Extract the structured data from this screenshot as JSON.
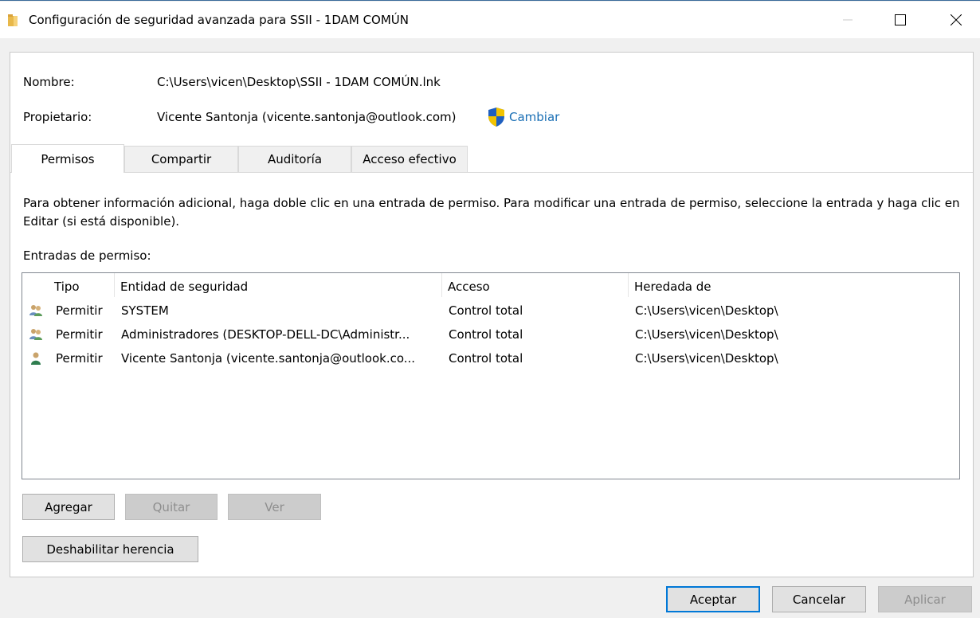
{
  "window": {
    "title": "Configuración de seguridad avanzada para SSII - 1DAM COMÚN",
    "icon": "folder-icon",
    "controls": [
      "minimize-icon",
      "maximize-icon",
      "close-icon"
    ]
  },
  "fields": {
    "name_label": "Nombre:",
    "name_value": "C:\\Users\\vicen\\Desktop\\SSII - 1DAM COMÚN.lnk",
    "owner_label": "Propietario:",
    "owner_value": "Vicente Santonja (vicente.santonja@outlook.com)",
    "change_link": "Cambiar"
  },
  "tabs": [
    {
      "label": "Permisos",
      "active": true
    },
    {
      "label": "Compartir",
      "active": false
    },
    {
      "label": "Auditoría",
      "active": false
    },
    {
      "label": "Acceso efectivo",
      "active": false
    }
  ],
  "info_text": "Para obtener información adicional, haga doble clic en una entrada de permiso. Para modificar una entrada de permiso, seleccione la entrada y haga clic en Editar (si está disponible).",
  "entries_label": "Entradas de permiso:",
  "table": {
    "columns": [
      "Tipo",
      "Entidad de seguridad",
      "Acceso",
      "Heredada de"
    ],
    "rows": [
      {
        "icon": "group-icon",
        "tipo": "Permitir",
        "entidad": "SYSTEM",
        "acceso": "Control total",
        "heredada": "C:\\Users\\vicen\\Desktop\\"
      },
      {
        "icon": "group-icon",
        "tipo": "Permitir",
        "entidad": "Administradores (DESKTOP-DELL-DC\\Administr...",
        "acceso": "Control total",
        "heredada": "C:\\Users\\vicen\\Desktop\\"
      },
      {
        "icon": "user-icon",
        "tipo": "Permitir",
        "entidad": "Vicente Santonja (vicente.santonja@outlook.co...",
        "acceso": "Control total",
        "heredada": "C:\\Users\\vicen\\Desktop\\"
      }
    ]
  },
  "buttons": {
    "add": "Agregar",
    "remove": "Quitar",
    "view": "Ver",
    "disable_inheritance": "Deshabilitar herencia",
    "ok": "Aceptar",
    "cancel": "Cancelar",
    "apply": "Aplicar"
  },
  "colors": {
    "link": "#1a6fb5",
    "accent": "#0078d7",
    "shield_blue": "#1f5fbf",
    "shield_yellow": "#f2c300"
  }
}
